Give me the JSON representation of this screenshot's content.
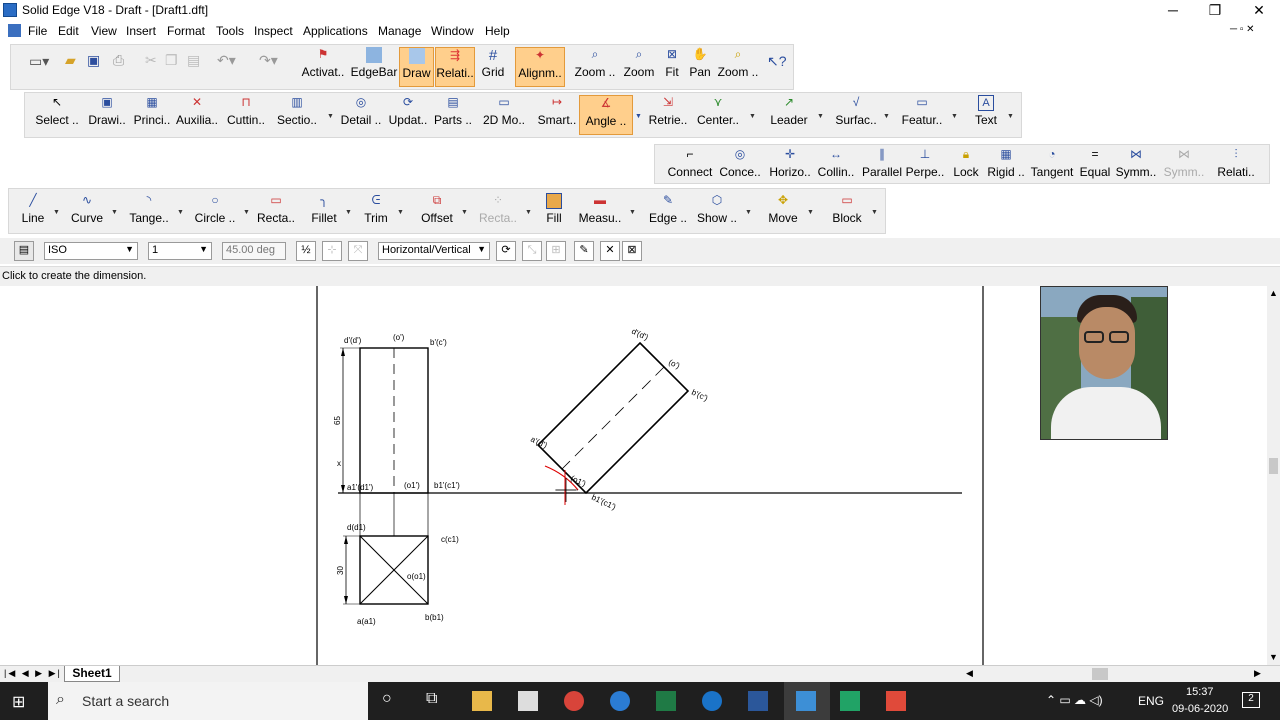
{
  "window": {
    "title": "Solid Edge V18 - Draft - [Draft1.dft]",
    "controls": [
      "─",
      "❐",
      "✕"
    ]
  },
  "menu": [
    "File",
    "Edit",
    "View",
    "Insert",
    "Format",
    "Tools",
    "Inspect",
    "Applications",
    "Manage",
    "Window",
    "Help"
  ],
  "toolbar1": [
    {
      "label": "Activat..",
      "icon": "activate-icon"
    },
    {
      "label": "EdgeBar",
      "icon": "edgebar-icon"
    },
    {
      "label": "Draw",
      "icon": "draw-icon",
      "hl": true
    },
    {
      "label": "Relati..",
      "icon": "relationships-icon",
      "hl": true
    },
    {
      "label": "Grid",
      "icon": "grid-icon"
    },
    {
      "label": "Alignm..",
      "icon": "alignment-icon",
      "hl": true
    },
    {
      "label": "Zoom ..",
      "icon": "zoom-area-icon"
    },
    {
      "label": "Zoom",
      "icon": "zoom-icon"
    },
    {
      "label": "Fit",
      "icon": "fit-icon"
    },
    {
      "label": "Pan",
      "icon": "pan-icon"
    },
    {
      "label": "Zoom ..",
      "icon": "zoom-dynamic-icon"
    }
  ],
  "toolbar2": [
    {
      "label": "Select ..",
      "icon": "select-icon"
    },
    {
      "label": "Drawi..",
      "icon": "drawing-view-icon"
    },
    {
      "label": "Princi..",
      "icon": "principal-view-icon"
    },
    {
      "label": "Auxilia..",
      "icon": "auxiliary-view-icon"
    },
    {
      "label": "Cuttin..",
      "icon": "cutting-plane-icon"
    },
    {
      "label": "Sectio..",
      "icon": "section-view-icon"
    },
    {
      "label": "Detail ..",
      "icon": "detail-view-icon"
    },
    {
      "label": "Updat..",
      "icon": "update-views-icon"
    },
    {
      "label": "Parts ..",
      "icon": "parts-list-icon"
    },
    {
      "label": "2D Mo..",
      "icon": "2d-model-icon"
    },
    {
      "label": "Smart..",
      "icon": "smart-dimension-icon"
    },
    {
      "label": "Angle ..",
      "icon": "angle-dimension-icon",
      "hl": true
    },
    {
      "label": "Retrie..",
      "icon": "retrieve-dimensions-icon"
    },
    {
      "label": "Center..",
      "icon": "center-mark-icon"
    },
    {
      "label": "Leader",
      "icon": "leader-icon"
    },
    {
      "label": "Surfac..",
      "icon": "surface-texture-icon"
    },
    {
      "label": "Featur..",
      "icon": "feature-control-icon"
    },
    {
      "label": "Text",
      "icon": "text-icon"
    }
  ],
  "relations": [
    {
      "label": "Connect",
      "icon": "connect-icon"
    },
    {
      "label": "Conce..",
      "icon": "concentric-icon"
    },
    {
      "label": "Horizo..",
      "icon": "horizontal-icon"
    },
    {
      "label": "Collin..",
      "icon": "collinear-icon"
    },
    {
      "label": "Parallel",
      "icon": "parallel-icon"
    },
    {
      "label": "Perpe..",
      "icon": "perpendicular-icon"
    },
    {
      "label": "Lock",
      "icon": "lock-icon"
    },
    {
      "label": "Rigid ..",
      "icon": "rigid-set-icon"
    },
    {
      "label": "Tangent",
      "icon": "tangent-icon"
    },
    {
      "label": "Equal",
      "icon": "equal-icon"
    },
    {
      "label": "Symm..",
      "icon": "symmetric-icon"
    },
    {
      "label": "Symm..",
      "icon": "symmetry-axis-icon",
      "disabled": true
    },
    {
      "label": "Relati..",
      "icon": "relationship-handles-icon"
    }
  ],
  "drawtools": [
    {
      "label": "Line",
      "icon": "line-icon"
    },
    {
      "label": "Curve",
      "icon": "curve-icon"
    },
    {
      "label": "Tange..",
      "icon": "tangent-arc-icon"
    },
    {
      "label": "Circle ..",
      "icon": "circle-icon"
    },
    {
      "label": "Recta..",
      "icon": "rectangle-icon"
    },
    {
      "label": "Fillet",
      "icon": "fillet-icon"
    },
    {
      "label": "Trim",
      "icon": "trim-icon"
    },
    {
      "label": "Offset",
      "icon": "offset-icon"
    },
    {
      "label": "Recta..",
      "icon": "rect-pattern-icon",
      "disabled": true
    },
    {
      "label": "Fill",
      "icon": "fill-icon"
    },
    {
      "label": "Measu..",
      "icon": "measure-icon"
    },
    {
      "label": "Edge ..",
      "icon": "edge-painter-icon"
    },
    {
      "label": "Show ..",
      "icon": "show-hide-icon"
    },
    {
      "label": "Move",
      "icon": "move-icon"
    },
    {
      "label": "Block",
      "icon": "block-icon"
    }
  ],
  "props": {
    "style": "ISO",
    "value": "1",
    "angle": "45.00 deg",
    "orientation": "Horizontal/Vertical"
  },
  "status": "Click to create the dimension.",
  "sheet_tab": "Sheet1",
  "drawing_labels": {
    "d1c1": "d'(d')",
    "o1": "(o')",
    "b1c1": "b'(c')",
    "dim65": "65",
    "x": "x",
    "a1d1": "a1'(d1')",
    "o11": "(o1')",
    "b11c11": "b1'(c1')",
    "dd1": "d(d1)",
    "cc1": "c(c1)",
    "oo1": "o(o1)",
    "dim30": "30",
    "aa1": "a(a1)",
    "bb1": "b(b1)",
    "rot_d": "d'(d')",
    "rot_o": "(o')",
    "rot_b": "b'(c')",
    "rot_a": "a'(d')",
    "rot_o1": "(o1')",
    "rot_b1": "b1'(c1')"
  },
  "taskbar": {
    "search": "Start a search",
    "lang": "ENG",
    "time": "15:37",
    "date": "09-06-2020",
    "notif": "2"
  }
}
